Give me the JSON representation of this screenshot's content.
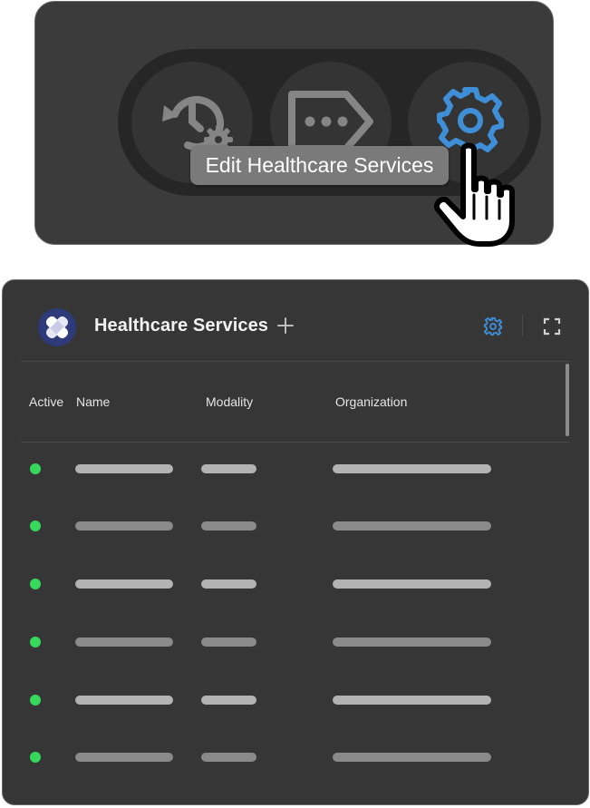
{
  "toolbar": {
    "buttons": [
      {
        "name": "history",
        "icon": "history-settings-icon"
      },
      {
        "name": "more",
        "icon": "tag-more-icon"
      },
      {
        "name": "settings",
        "icon": "gear-icon",
        "active_color": "#3f8fd8"
      }
    ],
    "tooltip": "Edit Healthcare Services"
  },
  "panel": {
    "logo_icon": "bandage-icon",
    "title": "Healthcare Services",
    "add_icon": "plus-icon",
    "settings_icon": "gear-icon",
    "expand_icon": "expand-icon",
    "columns": [
      "Active",
      "Name",
      "Modality",
      "Organization"
    ],
    "rows": [
      {
        "active": true
      },
      {
        "active": true
      },
      {
        "active": true
      },
      {
        "active": true
      },
      {
        "active": true
      },
      {
        "active": true
      }
    ],
    "active_color": "#35d85a",
    "accent_color": "#3f8fd8"
  }
}
